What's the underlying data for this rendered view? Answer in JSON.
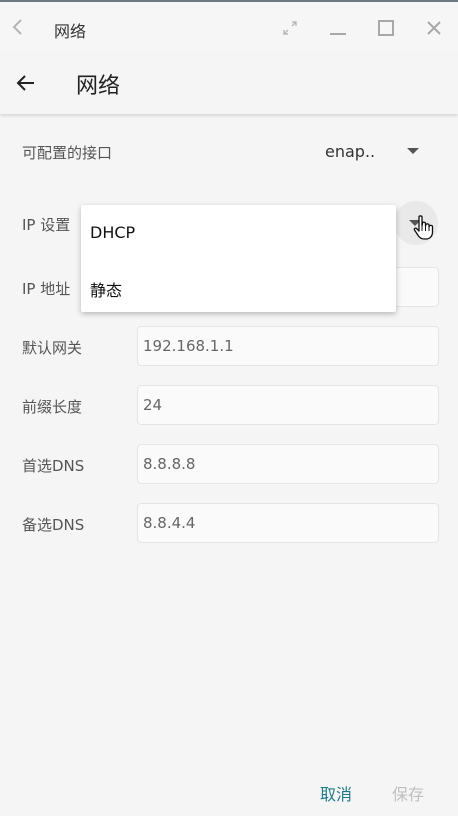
{
  "window": {
    "title": "网络"
  },
  "appbar": {
    "title": "网络"
  },
  "interface": {
    "label": "可配置的接口",
    "value": "enap.."
  },
  "ip_setting": {
    "label": "IP 设置"
  },
  "ip_address": {
    "label": "IP  地址",
    "value": ""
  },
  "gateway": {
    "label": "默认网关",
    "value": "192.168.1.1"
  },
  "prefix": {
    "label": "前缀长度",
    "value": "24"
  },
  "dns1": {
    "label": "首选DNS",
    "value": "8.8.8.8"
  },
  "dns2": {
    "label": "备选DNS",
    "value": "8.8.4.4"
  },
  "dropdown": {
    "options": [
      "DHCP",
      "静态"
    ]
  },
  "footer": {
    "cancel": "取消",
    "save": "保存"
  },
  "colors": {
    "accent": "#1e7a86",
    "disabled": "#c0c0c0"
  },
  "icons": [
    "chevron-left-icon",
    "expand-icon",
    "minimize-icon",
    "maximize-icon",
    "close-icon",
    "arrow-back-icon",
    "caret-down-icon",
    "pointer-cursor-icon"
  ]
}
